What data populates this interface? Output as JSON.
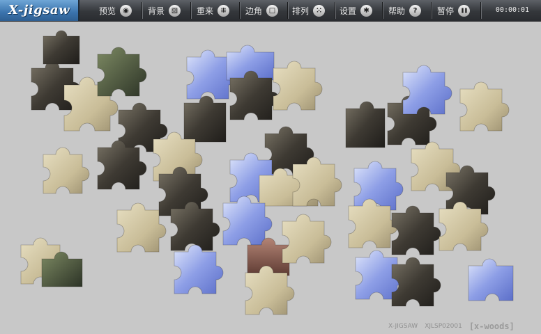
{
  "app": {
    "logo": "X-jigsaw"
  },
  "toolbar": {
    "items": [
      {
        "label": "预览",
        "icon": "eye-icon",
        "glyph": "◉"
      },
      {
        "label": "背景",
        "icon": "background-icon",
        "glyph": "▧"
      },
      {
        "label": "重来",
        "icon": "restart-icon",
        "glyph": "⁜"
      },
      {
        "label": "边角",
        "icon": "edges-icon",
        "glyph": "□"
      },
      {
        "label": "排列",
        "icon": "arrange-icon",
        "glyph": "⁙"
      },
      {
        "label": "设置",
        "icon": "settings-icon",
        "glyph": "✱"
      },
      {
        "label": "帮助",
        "icon": "help-icon",
        "glyph": "?"
      },
      {
        "label": "暂停",
        "icon": "pause-icon",
        "glyph": "❚❚"
      }
    ],
    "timer": "00:00:01"
  },
  "footer": {
    "product": "X-JIGSAW",
    "code": "XJLSP02001",
    "brand": "[x-woods]"
  },
  "colors": {
    "board": "#c8c8c8",
    "toolbar": "#3a3d41",
    "logo": "#3a73ad"
  }
}
